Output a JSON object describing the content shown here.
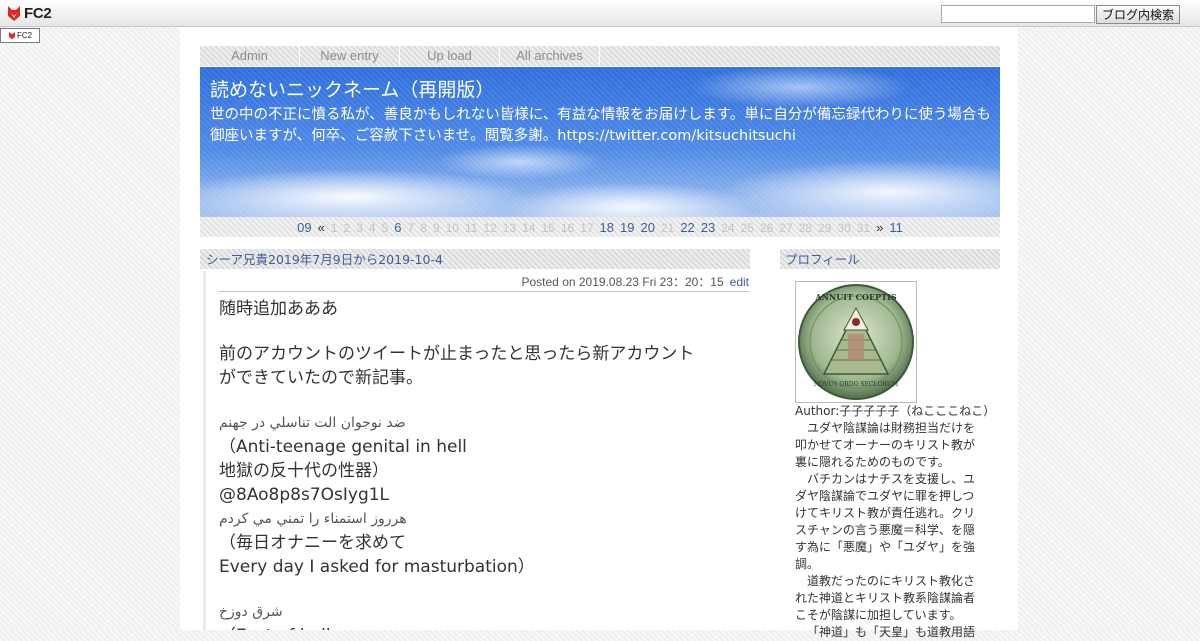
{
  "fc2bar": {
    "logo_text": "FC2",
    "search_placeholder": "",
    "search_button": "ブログ内検索",
    "mini_badge": "FC2"
  },
  "nav": [
    {
      "label": "Admin"
    },
    {
      "label": "New entry"
    },
    {
      "label": "Up load"
    },
    {
      "label": "All archives"
    }
  ],
  "header": {
    "title": "読めないニックネーム（再開版）",
    "description": "世の中の不正に憤る私が、善良かもしれない皆様に、有益な情報をお届けします。単に自分が備忘録代わりに使う場合も御座いますが、何卒、ご容赦下さいませ。閲覧多謝。https://twitter.com/kitsuchitsuchi"
  },
  "calendar": {
    "month": "09",
    "prev": "«",
    "next": "»",
    "next_month": "11",
    "days": [
      "1",
      "2",
      "3",
      "4",
      "5",
      "6",
      "7",
      "8",
      "9",
      "10",
      "11",
      "12",
      "13",
      "14",
      "15",
      "16",
      "17",
      "18",
      "19",
      "20",
      "21",
      "22",
      "23",
      "24",
      "25",
      "26",
      "27",
      "28",
      "29",
      "30",
      "31"
    ],
    "active_days": [
      "6",
      "18",
      "19",
      "20",
      "22",
      "23"
    ]
  },
  "entry": {
    "title": "シーア兄貴2019年7月9日から2019-10-4",
    "posted": "Posted on 2019.08.23 Fri 23：20：15",
    "edit": "edit",
    "lines": [
      "随時追加あああ",
      "",
      "前のアカウントのツイートが止まったと思ったら新アカウント",
      "ができていたので新記事。",
      "",
      "ضد نوجوان الت تناسلي در جهنم",
      "（Anti-teenage genital in hell",
      "地獄の反十代の性器）",
      "@8Ao8p8s7OsIyg1L",
      "هرروز استمناء را تمني مي كردم",
      "（毎日オナニーを求めて",
      "Every day I asked for masturbation）",
      "",
      "شرق دوزخ",
      "（East of hell"
    ]
  },
  "sidebar": {
    "profile_title": "プロフィール",
    "author": "Author:子子子子子（ねこここねこ）",
    "paragraphs": [
      "ユダヤ陰謀論は財務担当だけを叩かせてオーナーのキリスト教が裏に隠れるためのものです。",
      "バチカンはナチスを支援し、ユダヤ陰謀論でユダヤに罪を押しつけてキリスト教が責任逃れ。クリスチャンの言う悪魔＝科学、を隠す為に「悪魔」や「ユダヤ」を強調。",
      "道教だったのにキリスト教化された神道とキリスト教系陰謀論者こそが陰謀に加担しています。",
      "「神道」も「天皇」も道教用語"
    ],
    "seal_text_top": "ANNUIT COEPTIS",
    "seal_text_bottom": "NOVUS ORDO SECLORUM"
  },
  "colors": {
    "link": "#3e5d9e",
    "sky_top": "#2f6fdc",
    "sky_bottom": "#a7c4f0"
  }
}
